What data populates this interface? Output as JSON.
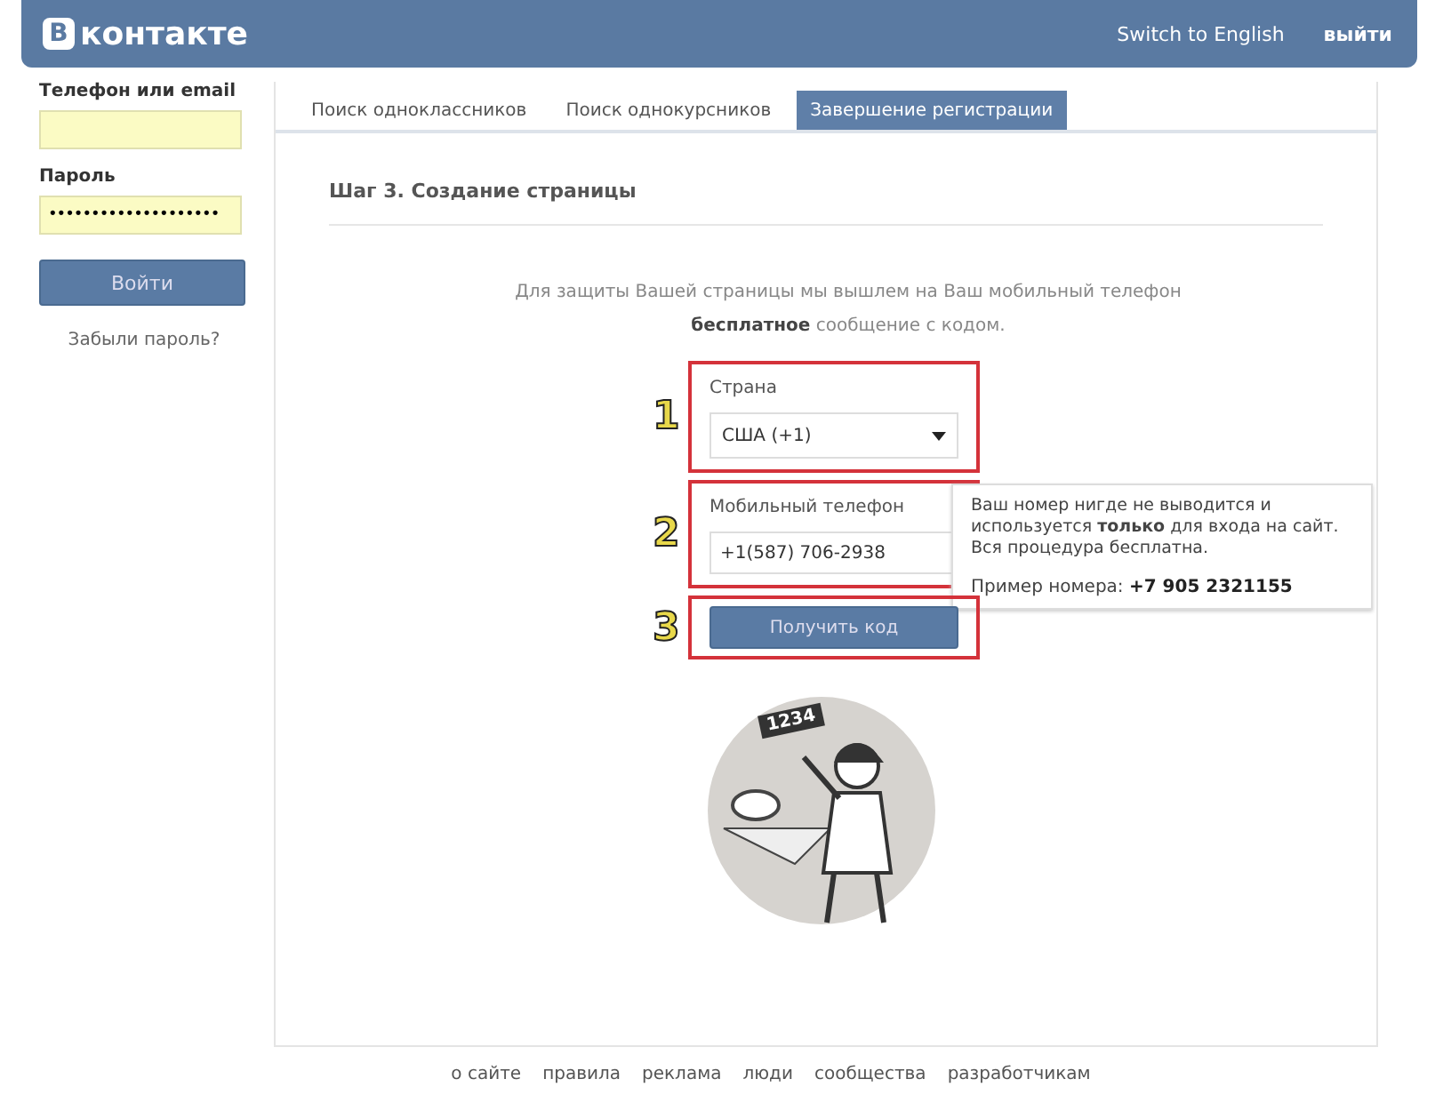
{
  "header": {
    "logo_badge": "В",
    "logo_text": "контакте",
    "links": [
      "Switch to English",
      "выйти"
    ]
  },
  "login": {
    "login_label": "Телефон или email",
    "password_label": "Пароль",
    "password_value": "••••••••••••••••••••",
    "submit": "Войти",
    "forgot": "Забыли пароль?"
  },
  "tabs": [
    {
      "label": "Поиск одноклассников",
      "selected": false
    },
    {
      "label": "Поиск однокурсников",
      "selected": false
    },
    {
      "label": "Завершение регистрации",
      "selected": true
    }
  ],
  "step_title": "Шаг 3. Создание страницы",
  "intro": "Для защиты Вашей страницы мы вышлем на Ваш мобильный телефон **бесплатное** сообщение с кодом.",
  "form": {
    "country_label": "Страна",
    "country_value": "США (+1)",
    "phone_label": "Мобильный телефон",
    "phone_value": "+1(587) 706-2938",
    "submit": "Получить код"
  },
  "markers": [
    "1",
    "2",
    "3"
  ],
  "tooltip": {
    "text": "Ваш номер нигде не выводится и используется **только** для входа на сайт. Вся процедура бесплатна.",
    "example_label": "Пример номера:",
    "example_value": "+7 905 2321155"
  },
  "illustration": {
    "card_text": "1234"
  },
  "footer": [
    "о сайте",
    "правила",
    "реклама",
    "люди",
    "сообщества",
    "разработчикам"
  ]
}
